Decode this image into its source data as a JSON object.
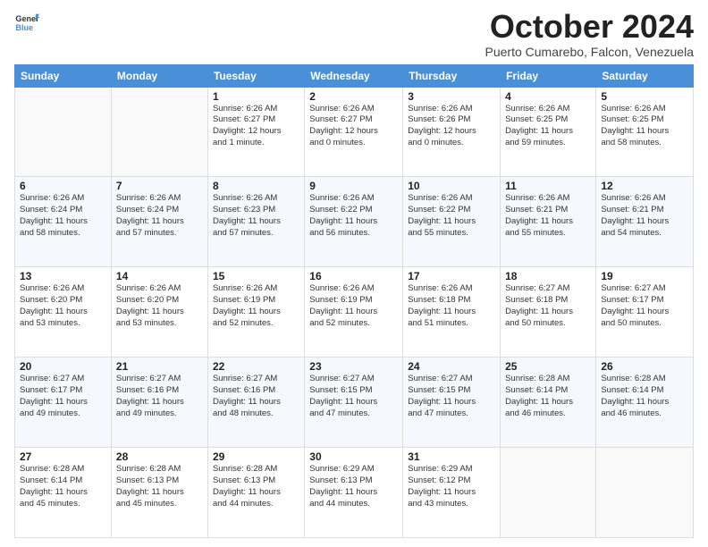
{
  "logo": {
    "line1": "General",
    "line2": "Blue"
  },
  "header": {
    "month": "October 2024",
    "location": "Puerto Cumarebo, Falcon, Venezuela"
  },
  "weekdays": [
    "Sunday",
    "Monday",
    "Tuesday",
    "Wednesday",
    "Thursday",
    "Friday",
    "Saturday"
  ],
  "weeks": [
    [
      {
        "day": "",
        "info": ""
      },
      {
        "day": "",
        "info": ""
      },
      {
        "day": "1",
        "info": "Sunrise: 6:26 AM\nSunset: 6:27 PM\nDaylight: 12 hours\nand 1 minute."
      },
      {
        "day": "2",
        "info": "Sunrise: 6:26 AM\nSunset: 6:27 PM\nDaylight: 12 hours\nand 0 minutes."
      },
      {
        "day": "3",
        "info": "Sunrise: 6:26 AM\nSunset: 6:26 PM\nDaylight: 12 hours\nand 0 minutes."
      },
      {
        "day": "4",
        "info": "Sunrise: 6:26 AM\nSunset: 6:25 PM\nDaylight: 11 hours\nand 59 minutes."
      },
      {
        "day": "5",
        "info": "Sunrise: 6:26 AM\nSunset: 6:25 PM\nDaylight: 11 hours\nand 58 minutes."
      }
    ],
    [
      {
        "day": "6",
        "info": "Sunrise: 6:26 AM\nSunset: 6:24 PM\nDaylight: 11 hours\nand 58 minutes."
      },
      {
        "day": "7",
        "info": "Sunrise: 6:26 AM\nSunset: 6:24 PM\nDaylight: 11 hours\nand 57 minutes."
      },
      {
        "day": "8",
        "info": "Sunrise: 6:26 AM\nSunset: 6:23 PM\nDaylight: 11 hours\nand 57 minutes."
      },
      {
        "day": "9",
        "info": "Sunrise: 6:26 AM\nSunset: 6:22 PM\nDaylight: 11 hours\nand 56 minutes."
      },
      {
        "day": "10",
        "info": "Sunrise: 6:26 AM\nSunset: 6:22 PM\nDaylight: 11 hours\nand 55 minutes."
      },
      {
        "day": "11",
        "info": "Sunrise: 6:26 AM\nSunset: 6:21 PM\nDaylight: 11 hours\nand 55 minutes."
      },
      {
        "day": "12",
        "info": "Sunrise: 6:26 AM\nSunset: 6:21 PM\nDaylight: 11 hours\nand 54 minutes."
      }
    ],
    [
      {
        "day": "13",
        "info": "Sunrise: 6:26 AM\nSunset: 6:20 PM\nDaylight: 11 hours\nand 53 minutes."
      },
      {
        "day": "14",
        "info": "Sunrise: 6:26 AM\nSunset: 6:20 PM\nDaylight: 11 hours\nand 53 minutes."
      },
      {
        "day": "15",
        "info": "Sunrise: 6:26 AM\nSunset: 6:19 PM\nDaylight: 11 hours\nand 52 minutes."
      },
      {
        "day": "16",
        "info": "Sunrise: 6:26 AM\nSunset: 6:19 PM\nDaylight: 11 hours\nand 52 minutes."
      },
      {
        "day": "17",
        "info": "Sunrise: 6:26 AM\nSunset: 6:18 PM\nDaylight: 11 hours\nand 51 minutes."
      },
      {
        "day": "18",
        "info": "Sunrise: 6:27 AM\nSunset: 6:18 PM\nDaylight: 11 hours\nand 50 minutes."
      },
      {
        "day": "19",
        "info": "Sunrise: 6:27 AM\nSunset: 6:17 PM\nDaylight: 11 hours\nand 50 minutes."
      }
    ],
    [
      {
        "day": "20",
        "info": "Sunrise: 6:27 AM\nSunset: 6:17 PM\nDaylight: 11 hours\nand 49 minutes."
      },
      {
        "day": "21",
        "info": "Sunrise: 6:27 AM\nSunset: 6:16 PM\nDaylight: 11 hours\nand 49 minutes."
      },
      {
        "day": "22",
        "info": "Sunrise: 6:27 AM\nSunset: 6:16 PM\nDaylight: 11 hours\nand 48 minutes."
      },
      {
        "day": "23",
        "info": "Sunrise: 6:27 AM\nSunset: 6:15 PM\nDaylight: 11 hours\nand 47 minutes."
      },
      {
        "day": "24",
        "info": "Sunrise: 6:27 AM\nSunset: 6:15 PM\nDaylight: 11 hours\nand 47 minutes."
      },
      {
        "day": "25",
        "info": "Sunrise: 6:28 AM\nSunset: 6:14 PM\nDaylight: 11 hours\nand 46 minutes."
      },
      {
        "day": "26",
        "info": "Sunrise: 6:28 AM\nSunset: 6:14 PM\nDaylight: 11 hours\nand 46 minutes."
      }
    ],
    [
      {
        "day": "27",
        "info": "Sunrise: 6:28 AM\nSunset: 6:14 PM\nDaylight: 11 hours\nand 45 minutes."
      },
      {
        "day": "28",
        "info": "Sunrise: 6:28 AM\nSunset: 6:13 PM\nDaylight: 11 hours\nand 45 minutes."
      },
      {
        "day": "29",
        "info": "Sunrise: 6:28 AM\nSunset: 6:13 PM\nDaylight: 11 hours\nand 44 minutes."
      },
      {
        "day": "30",
        "info": "Sunrise: 6:29 AM\nSunset: 6:13 PM\nDaylight: 11 hours\nand 44 minutes."
      },
      {
        "day": "31",
        "info": "Sunrise: 6:29 AM\nSunset: 6:12 PM\nDaylight: 11 hours\nand 43 minutes."
      },
      {
        "day": "",
        "info": ""
      },
      {
        "day": "",
        "info": ""
      }
    ]
  ]
}
